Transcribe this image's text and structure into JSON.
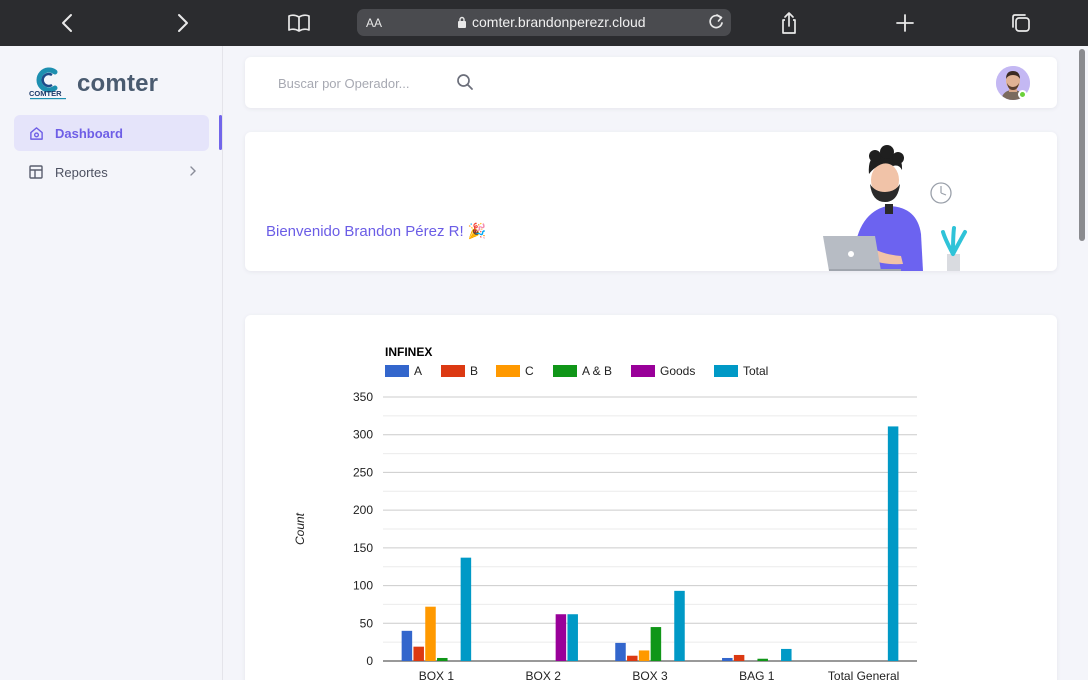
{
  "browser": {
    "url_aa": "AA",
    "url": "comter.brandonperezr.cloud"
  },
  "brand": {
    "name": "comter",
    "mark_text": "COMTER"
  },
  "sidebar": {
    "items": [
      {
        "label": "Dashboard",
        "icon": "home-icon",
        "active": true
      },
      {
        "label": "Reportes",
        "icon": "layout-icon",
        "active": false
      }
    ]
  },
  "search": {
    "placeholder": "Buscar por Operador..."
  },
  "welcome": {
    "message": "Bienvenido Brandon Pérez R! 🎉"
  },
  "colors": {
    "accent": "#7266ea",
    "series_A": "#3366cc",
    "series_B": "#dc3912",
    "series_C": "#ff9900",
    "series_AB": "#109618",
    "series_Goods": "#990099",
    "series_Total": "#0099c6"
  },
  "chart_data": {
    "type": "bar",
    "title": "INFINEX",
    "ylabel": "Count",
    "xlabel": "",
    "ylim": [
      0,
      350
    ],
    "yticks": [
      0,
      50,
      100,
      150,
      200,
      250,
      300,
      350
    ],
    "legend_position": "top",
    "grid": true,
    "categories": [
      "BOX 1",
      "BOX 2",
      "BOX 3",
      "BAG 1",
      "Total General"
    ],
    "series": [
      {
        "name": "A",
        "color": "#3366cc",
        "values": [
          40,
          0,
          24,
          4,
          0
        ]
      },
      {
        "name": "B",
        "color": "#dc3912",
        "values": [
          19,
          0,
          7,
          8,
          0
        ]
      },
      {
        "name": "C",
        "color": "#ff9900",
        "values": [
          72,
          0,
          14,
          0,
          0
        ]
      },
      {
        "name": "A & B",
        "color": "#109618",
        "values": [
          4,
          0,
          45,
          3,
          0
        ]
      },
      {
        "name": "Goods",
        "color": "#990099",
        "values": [
          0,
          62,
          0,
          0,
          0
        ]
      },
      {
        "name": "Total",
        "color": "#0099c6",
        "values": [
          137,
          62,
          93,
          16,
          311
        ]
      }
    ]
  }
}
